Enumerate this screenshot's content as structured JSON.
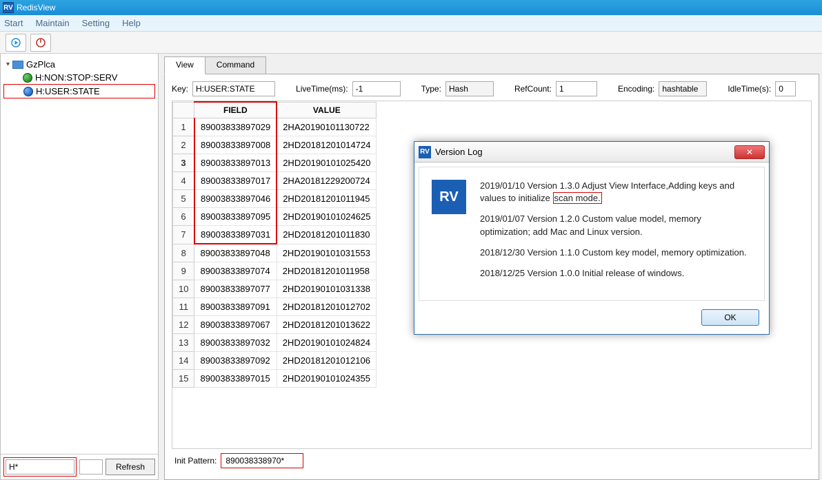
{
  "window": {
    "title": "RedisView",
    "icon_text": "RV"
  },
  "menu": {
    "start": "Start",
    "maintain": "Maintain",
    "setting": "Setting",
    "help": "Help"
  },
  "sidebar": {
    "connection": "GzPlca",
    "items": [
      "H:NON:STOP:SERV",
      "H:USER:STATE"
    ],
    "pattern": "H*",
    "refresh": "Refresh"
  },
  "tabs": {
    "view": "View",
    "command": "Command"
  },
  "props": {
    "key_label": "Key:",
    "key": "H:USER:STATE",
    "lt_label": "LiveTime(ms):",
    "lt": "-1",
    "type_label": "Type:",
    "type": "Hash",
    "rc_label": "RefCount:",
    "rc": "1",
    "enc_label": "Encoding:",
    "enc": "hashtable",
    "idle_label": "IdleTime(s):",
    "idle": "0"
  },
  "grid": {
    "headers": {
      "field": "FIELD",
      "value": "VALUE"
    },
    "rows": [
      {
        "n": "1",
        "f": "89003833897029",
        "v": "2HA20190101130722"
      },
      {
        "n": "2",
        "f": "89003833897008",
        "v": "2HD20181201014724"
      },
      {
        "n": "3",
        "f": "89003833897013",
        "v": "2HD20190101025420"
      },
      {
        "n": "4",
        "f": "89003833897017",
        "v": "2HA20181229200724"
      },
      {
        "n": "5",
        "f": "89003833897046",
        "v": "2HD20181201011945"
      },
      {
        "n": "6",
        "f": "89003833897095",
        "v": "2HD20190101024625"
      },
      {
        "n": "7",
        "f": "89003833897031",
        "v": "2HD20181201011830"
      },
      {
        "n": "8",
        "f": "89003833897048",
        "v": "2HD20190101031553"
      },
      {
        "n": "9",
        "f": "89003833897074",
        "v": "2HD20181201011958"
      },
      {
        "n": "10",
        "f": "89003833897077",
        "v": "2HD20190101031338"
      },
      {
        "n": "11",
        "f": "89003833897091",
        "v": "2HD20181201012702"
      },
      {
        "n": "12",
        "f": "89003833897067",
        "v": "2HD20181201013622"
      },
      {
        "n": "13",
        "f": "89003833897032",
        "v": "2HD20190101024824"
      },
      {
        "n": "14",
        "f": "89003833897092",
        "v": "2HD20181201012106"
      },
      {
        "n": "15",
        "f": "89003833897015",
        "v": "2HD20190101024355"
      }
    ]
  },
  "init": {
    "label": "Init Pattern:",
    "value": "890038338970*"
  },
  "dialog": {
    "title": "Version Log",
    "entries": [
      {
        "pre": "2019/01/10  Version 1.3.0  Adjust View Interface,Adding keys and values to initialize ",
        "hl": "scan mode.",
        "post": ""
      },
      {
        "pre": "2019/01/07  Version 1.2.0  Custom value model, memory optimization; add Mac and Linux version.",
        "hl": "",
        "post": ""
      },
      {
        "pre": "2018/12/30  Version 1.1.0  Custom key model, memory optimization.",
        "hl": "",
        "post": ""
      },
      {
        "pre": "2018/12/25  Version 1.0.0  Initial release of windows.",
        "hl": "",
        "post": ""
      }
    ],
    "ok": "OK",
    "close_glyph": "✕"
  }
}
